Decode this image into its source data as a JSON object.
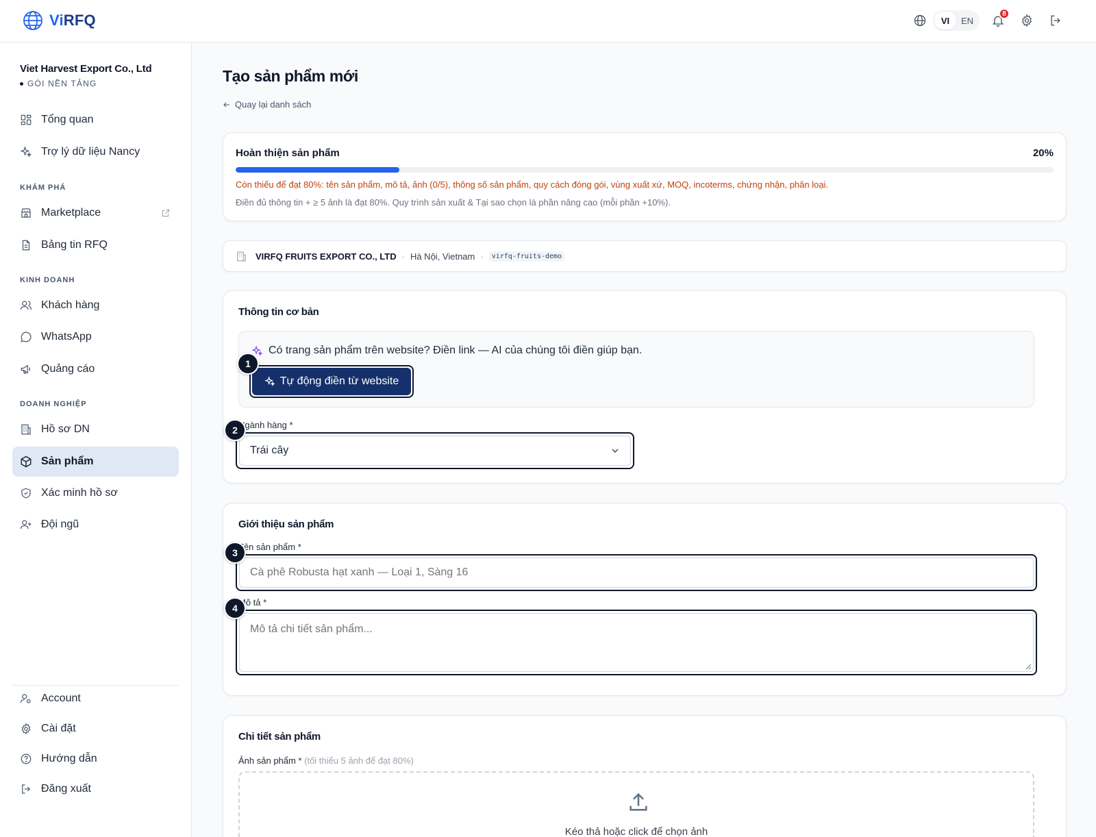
{
  "header": {
    "logo_text_accent": "Vi",
    "logo_text_rest": "RFQ",
    "lang_vi": "VI",
    "lang_en": "EN",
    "notification_count": "8"
  },
  "sidebar": {
    "company_name": "Viet Harvest Export Co., Ltd",
    "plan": "GÓI NỀN TẢNG",
    "items": {
      "overview": "Tổng quan",
      "assistant": "Trợ lý dữ liệu Nancy",
      "marketplace": "Marketplace",
      "rfq_board": "Bảng tin RFQ",
      "customers": "Khách hàng",
      "whatsapp": "WhatsApp",
      "ads": "Quảng cáo",
      "company_profile": "Hồ sơ DN",
      "products": "Sản phẩm",
      "verify": "Xác minh hồ sơ",
      "team": "Đội ngũ",
      "account": "Account",
      "settings": "Cài đặt",
      "guide": "Hướng dẫn",
      "logout": "Đăng xuất"
    },
    "sections": {
      "explore": "KHÁM PHÁ",
      "business": "KINH DOANH",
      "enterprise": "DOANH NGHIỆP"
    }
  },
  "page": {
    "title": "Tạo sản phẩm mới",
    "back_link": "Quay lại danh sách"
  },
  "progress": {
    "title": "Hoàn thiện sản phẩm",
    "percent_label": "20%",
    "value": 0.2,
    "missing": "Còn thiếu để đạt 80%: tên sản phẩm, mô tả, ảnh (0/5), thông số sản phẩm, quy cách đóng gói, vùng xuất xứ, MOQ, incoterms, chứng nhận, phân loại.",
    "hint": "Điền đủ thông tin + ≥ 5 ảnh là đạt 80%. Quy trình sản xuất & Tại sao chọn là phần nâng cao (mỗi phần +10%)."
  },
  "company_bar": {
    "name": "VIRFQ FRUITS EXPORT CO., LTD",
    "separator": "·",
    "location": "Hà Nội, Vietnam",
    "slug": "virfq-fruits-demo"
  },
  "basic": {
    "title": "Thông tin cơ bản",
    "ai_prompt": "Có trang sản phẩm trên website? Điền link — AI của chúng tôi điền giúp bạn.",
    "ai_button": "Tự động điền từ website",
    "category_label": "Ngành hàng *",
    "category_value": "Trái cây"
  },
  "intro": {
    "title": "Giới thiệu sản phẩm",
    "name_label": "Tên sản phẩm *",
    "name_placeholder": "Cà phê Robusta hạt xanh — Loại 1, Sàng 16",
    "desc_label": "Mô tả *",
    "desc_placeholder": "Mô tả chi tiết sản phẩm..."
  },
  "details": {
    "title": "Chi tiết sản phẩm",
    "images_label": "Ảnh sản phẩm *",
    "images_hint": "(tối thiểu 5 ảnh để đạt 80%)",
    "drop_text": "Kéo thả hoặc click để chọn ảnh"
  },
  "steps": [
    "1",
    "2",
    "3",
    "4"
  ],
  "colors": {
    "primary": "#15306a",
    "accent": "#2563eb",
    "warning_text": "#c2410c",
    "active_nav": "#e0e7f5"
  }
}
